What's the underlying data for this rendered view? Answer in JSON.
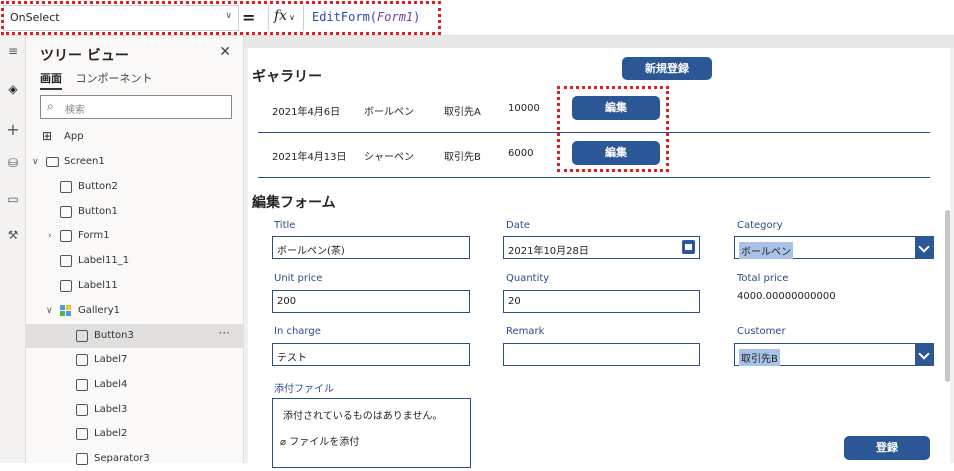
{
  "formula_bar": {
    "property": "OnSelect",
    "equals": "=",
    "fx_label": "fx",
    "formula_func": "EditForm(",
    "formula_arg": "Form1",
    "formula_close": ")"
  },
  "tree_view": {
    "title": "ツリー ビュー",
    "tabs": [
      "画面",
      "コンポーネント"
    ],
    "search_placeholder": "検索",
    "items": [
      {
        "label": "App"
      },
      {
        "label": "Screen1"
      },
      {
        "label": "Button2"
      },
      {
        "label": "Button1"
      },
      {
        "label": "Form1"
      },
      {
        "label": "Label11_1"
      },
      {
        "label": "Label11"
      },
      {
        "label": "Gallery1"
      },
      {
        "label": "Button3"
      },
      {
        "label": "Label7"
      },
      {
        "label": "Label4"
      },
      {
        "label": "Label3"
      },
      {
        "label": "Label2"
      },
      {
        "label": "Separator3"
      }
    ]
  },
  "gallery": {
    "title": "ギャラリー",
    "new_button": "新規登録",
    "rows": [
      {
        "date": "2021年4月6日",
        "item": "ボールペン",
        "customer": "取引先A",
        "amount": "10000",
        "edit": "編集"
      },
      {
        "date": "2021年4月13日",
        "item": "シャーペン",
        "customer": "取引先B",
        "amount": "6000",
        "edit": "編集"
      }
    ]
  },
  "form": {
    "title": "編集フォーム",
    "fields": {
      "title": {
        "label": "Title",
        "value": "ボールペン(茶)"
      },
      "date": {
        "label": "Date",
        "value": "2021年10月28日"
      },
      "category": {
        "label": "Category",
        "value": "ボールペン"
      },
      "unit_price": {
        "label": "Unit price",
        "value": "200"
      },
      "quantity": {
        "label": "Quantity",
        "value": "20"
      },
      "total_price": {
        "label": "Total price",
        "value": "4000.00000000000"
      },
      "in_charge": {
        "label": "In charge",
        "value": "テスト"
      },
      "remark": {
        "label": "Remark",
        "value": ""
      },
      "customer": {
        "label": "Customer",
        "value": "取引先B"
      },
      "attachments": {
        "label": "添付ファイル",
        "empty_text": "添付されているものはありません。",
        "add_label": "ファイルを添付"
      }
    },
    "submit_button": "登録"
  },
  "colors": {
    "primary": "#2b5796",
    "highlight": "#e02020",
    "field_border": "#2b4d8a"
  }
}
